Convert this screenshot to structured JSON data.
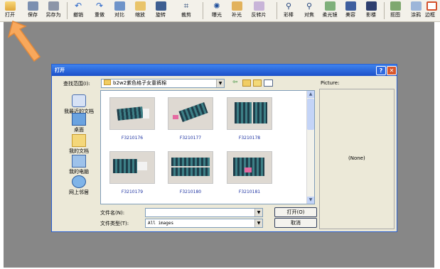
{
  "toolbar": {
    "buttons": [
      {
        "label": "打开",
        "icon": "open-folder-icon"
      },
      {
        "label": "保存",
        "icon": "save-icon"
      },
      {
        "label": "另存为",
        "icon": "save-as-icon"
      },
      {
        "label": "撤销",
        "icon": "undo-icon"
      },
      {
        "label": "重做",
        "icon": "redo-icon"
      },
      {
        "label": "对比",
        "icon": "compare-icon"
      },
      {
        "label": "缩放",
        "icon": "resize-icon"
      },
      {
        "label": "旋转",
        "icon": "rotate-icon"
      },
      {
        "label": "裁剪",
        "icon": "crop-icon"
      },
      {
        "label": "曝光",
        "icon": "exposure-icon"
      },
      {
        "label": "补光",
        "icon": "fill-light-icon"
      },
      {
        "label": "反转片",
        "icon": "reversal-film-icon"
      },
      {
        "label": "彩棒",
        "icon": "color-wand-icon"
      },
      {
        "label": "对焦",
        "icon": "focus-icon"
      },
      {
        "label": "柔光镜",
        "icon": "soft-lens-icon"
      },
      {
        "label": "美容",
        "icon": "beauty-icon"
      },
      {
        "label": "影楼",
        "icon": "studio-icon"
      },
      {
        "label": "抠图",
        "icon": "cutout-icon"
      },
      {
        "label": "涂鸦",
        "icon": "doodle-icon"
      },
      {
        "label": "边框",
        "icon": "border-icon"
      }
    ]
  },
  "dialog": {
    "title": "打开",
    "help_button": "?",
    "close_button": "✕",
    "look_in_label": "查找范围(I):",
    "look_in_value": "b2w2紫色格子女童裤棉",
    "picture_label": "Picture:",
    "preview_text": "(None)",
    "places": [
      {
        "label": "我最近的文档",
        "icon": "recent-documents-icon"
      },
      {
        "label": "桌面",
        "icon": "desktop-icon"
      },
      {
        "label": "我的文档",
        "icon": "my-documents-icon"
      },
      {
        "label": "我的电脑",
        "icon": "my-computer-icon"
      },
      {
        "label": "网上邻居",
        "icon": "network-places-icon"
      }
    ],
    "files": [
      {
        "name": "F3210176"
      },
      {
        "name": "F3210177"
      },
      {
        "name": "F3210178"
      },
      {
        "name": "F3210179"
      },
      {
        "name": "F3210180"
      },
      {
        "name": "F3210181"
      }
    ],
    "filename_label": "文件名(N):",
    "filename_value": "",
    "filetype_label": "文件类型(T):",
    "filetype_value": "All images",
    "open_button": "打开(O)",
    "cancel_button": "取消"
  },
  "colors": {
    "accent_arrow": "#f39a4b",
    "titlebar": "#2459d6",
    "workspace": "#878787"
  }
}
